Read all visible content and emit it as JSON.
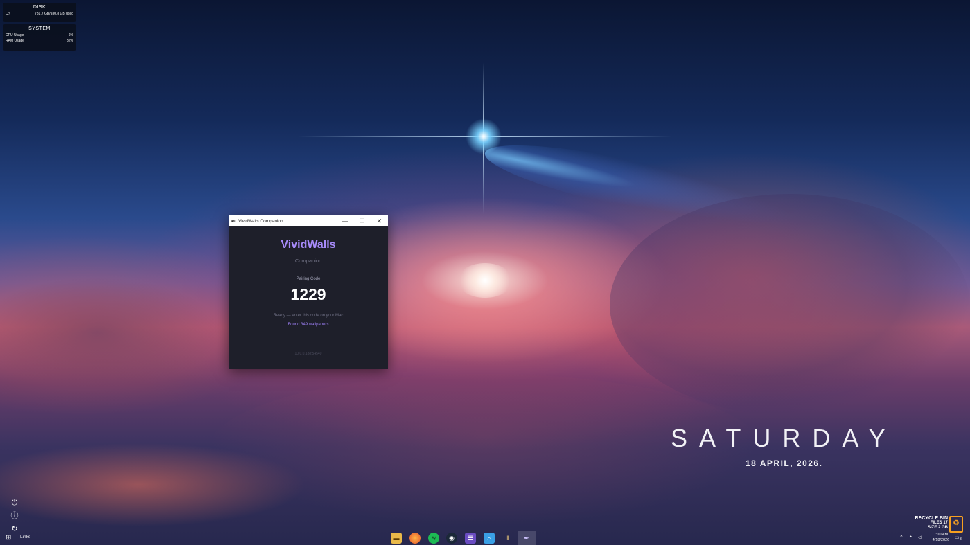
{
  "colors": {
    "accent": "#a78bfa",
    "window_bg": "#1e1f2a",
    "disk_bar": "#c9a227",
    "recycle_icon": "#f7a020"
  },
  "disk_widget": {
    "title": "DISK",
    "drive": "C:\\",
    "usage": "731.7 GB/930.8 GB used"
  },
  "system_widget": {
    "title": "SYSTEM",
    "rows": [
      {
        "label": "CPU Usage",
        "value": "6%"
      },
      {
        "label": "RAM Usage",
        "value": "32%"
      }
    ]
  },
  "window": {
    "title": "VividWalls Companion",
    "icon": "feather-icon",
    "controls": {
      "minimize": "—",
      "maximize": "☐",
      "close": "✕"
    },
    "brand": "VividWalls",
    "subtitle": "Companion",
    "pairing_label": "Pairing Code",
    "pairing_code": "1229",
    "status": "Ready — enter this code on your Mac",
    "found": "Found 349 wallpapers",
    "address": "10.0.0.188:54540"
  },
  "desktop": {
    "day": "SATURDAY",
    "date": "18  APRIL, 2026."
  },
  "side_icons": [
    "power-icon",
    "info-icon",
    "refresh-icon"
  ],
  "recycle_bin": {
    "title": "RECYCLE BIN",
    "files": "FILES 17",
    "size": "SIZE 2 GB"
  },
  "taskbar": {
    "links_label": "Links",
    "apps": [
      "file-explorer-icon",
      "firefox-icon",
      "spotify-icon",
      "steam-icon",
      "app-icon",
      "search-app-icon",
      "equalizer-icon",
      "vividwalls-icon"
    ],
    "clock_time": "7:10 AM",
    "clock_date": "4/18/2026",
    "notification_count": "3"
  }
}
